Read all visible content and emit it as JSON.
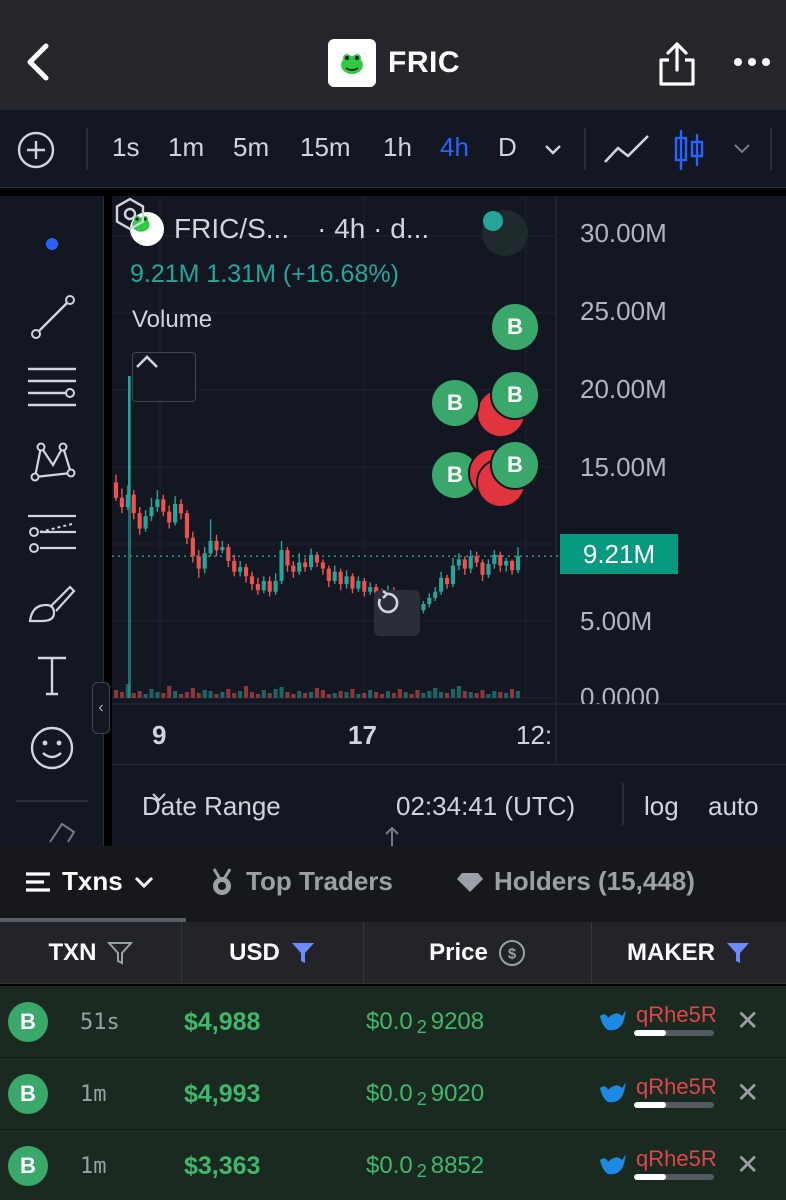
{
  "header": {
    "title": "FRIC"
  },
  "toolbar": {
    "timeframes": [
      "1s",
      "1m",
      "5m",
      "15m",
      "1h",
      "4h",
      "D"
    ],
    "active_timeframe": "4h"
  },
  "chart": {
    "legend_symbol": "FRIC/S...",
    "legend_interval": "· 4h · d...",
    "legend_values": "9.21M  1.31M (+16.68%)",
    "volume_label": "Volume",
    "y_ticks": [
      "30.00M",
      "25.00M",
      "20.00M",
      "15.00M",
      "5.00M",
      "0.0000"
    ],
    "current_price_label": "9.21M",
    "x_ticks": [
      "9",
      "17",
      "12:"
    ],
    "footer": {
      "date_range": "Date Range",
      "clock": "02:34:41 (UTC)",
      "log": "log",
      "auto": "auto"
    },
    "colors": {
      "up": "#26a69a",
      "down": "#ef5350",
      "accent": "#2962ff"
    }
  },
  "chart_data": {
    "type": "candlestick",
    "ylabel": "",
    "ylim": [
      0,
      30000000
    ],
    "current_value": 9210000,
    "candles": [
      [
        14.0,
        13.0,
        14.5,
        12.8
      ],
      [
        13.0,
        12.4,
        13.6,
        12.0
      ],
      [
        12.4,
        13.2,
        13.8,
        12.2
      ],
      [
        13.2,
        12.0,
        13.5,
        11.6
      ],
      [
        12.0,
        11.0,
        12.4,
        10.6
      ],
      [
        11.0,
        11.8,
        12.2,
        10.8
      ],
      [
        11.8,
        12.4,
        13.0,
        11.5
      ],
      [
        12.4,
        12.9,
        13.5,
        12.1
      ],
      [
        12.9,
        12.1,
        13.2,
        11.8
      ],
      [
        12.1,
        11.4,
        12.5,
        11.0
      ],
      [
        11.4,
        12.6,
        13.1,
        11.2
      ],
      [
        12.6,
        12.0,
        12.9,
        11.6
      ],
      [
        12.0,
        10.4,
        12.2,
        10.0
      ],
      [
        10.4,
        9.2,
        10.8,
        8.8
      ],
      [
        9.2,
        8.4,
        9.6,
        7.8
      ],
      [
        8.4,
        9.4,
        9.8,
        8.1
      ],
      [
        9.4,
        10.2,
        11.6,
        9.2
      ],
      [
        10.2,
        9.6,
        10.6,
        9.2
      ],
      [
        9.6,
        9.8,
        10.2,
        9.4
      ],
      [
        9.8,
        8.9,
        10.0,
        8.5
      ],
      [
        8.9,
        8.2,
        9.3,
        7.9
      ],
      [
        8.2,
        8.5,
        8.9,
        7.9
      ],
      [
        8.5,
        7.9,
        8.7,
        7.5
      ],
      [
        7.9,
        7.4,
        8.2,
        7.0
      ],
      [
        7.4,
        7.0,
        7.8,
        6.7
      ],
      [
        7.0,
        7.6,
        7.9,
        6.8
      ],
      [
        7.6,
        6.9,
        7.9,
        6.6
      ],
      [
        6.9,
        7.6,
        8.1,
        6.7
      ],
      [
        7.6,
        9.6,
        10.2,
        7.4
      ],
      [
        9.6,
        8.6,
        9.8,
        8.2
      ],
      [
        8.6,
        8.2,
        8.9,
        7.8
      ],
      [
        8.2,
        8.8,
        9.4,
        8.0
      ],
      [
        8.8,
        8.5,
        9.1,
        8.2
      ],
      [
        8.5,
        9.3,
        9.7,
        8.3
      ],
      [
        9.3,
        8.8,
        9.5,
        8.5
      ],
      [
        8.8,
        8.4,
        9.0,
        8.0
      ],
      [
        8.4,
        7.6,
        8.6,
        7.2
      ],
      [
        7.6,
        8.2,
        8.6,
        7.4
      ],
      [
        8.2,
        7.4,
        8.4,
        7.0
      ],
      [
        7.4,
        7.9,
        8.3,
        7.1
      ],
      [
        7.9,
        7.1,
        8.1,
        6.8
      ],
      [
        7.1,
        7.6,
        7.9,
        6.9
      ],
      [
        7.6,
        6.9,
        7.8,
        6.6
      ],
      [
        6.9,
        7.2,
        7.5,
        6.7
      ],
      [
        7.2,
        6.8,
        7.4,
        6.5
      ],
      [
        6.8,
        6.6,
        7.1,
        6.3
      ],
      [
        6.6,
        7.0,
        7.3,
        6.4
      ],
      [
        7.0,
        6.7,
        7.2,
        6.4
      ],
      [
        6.7,
        6.4,
        6.9,
        6.1
      ],
      [
        6.4,
        6.8,
        7.0,
        6.2
      ],
      [
        6.8,
        6.5,
        7.0,
        6.2
      ],
      [
        6.5,
        5.7,
        6.6,
        5.5
      ],
      [
        5.7,
        6.1,
        6.3,
        5.5
      ],
      [
        6.1,
        6.5,
        6.8,
        5.9
      ],
      [
        6.5,
        6.9,
        7.2,
        6.3
      ],
      [
        6.9,
        7.8,
        8.2,
        6.7
      ],
      [
        7.8,
        7.4,
        8.0,
        7.1
      ],
      [
        7.4,
        8.6,
        9.1,
        7.2
      ],
      [
        8.6,
        9.0,
        9.4,
        8.3
      ],
      [
        9.0,
        8.4,
        9.2,
        8.0
      ],
      [
        8.4,
        9.2,
        9.6,
        8.1
      ],
      [
        9.2,
        8.8,
        9.5,
        8.5
      ],
      [
        8.8,
        8.0,
        9.0,
        7.6
      ],
      [
        8.0,
        8.7,
        9.0,
        7.8
      ],
      [
        8.7,
        9.3,
        9.6,
        8.4
      ],
      [
        9.3,
        8.6,
        9.5,
        8.2
      ],
      [
        8.6,
        8.9,
        9.1,
        8.2
      ],
      [
        8.9,
        8.3,
        9.0,
        8.0
      ],
      [
        8.3,
        9.21,
        9.8,
        8.1
      ]
    ]
  },
  "tabs": [
    {
      "label": "Txns"
    },
    {
      "label": "Top Traders"
    },
    {
      "label": "Holders (15,448)"
    }
  ],
  "table": {
    "headers": [
      "TXN",
      "USD",
      "Price",
      "MAKER"
    ],
    "rows": [
      {
        "type": "B",
        "age": "51s",
        "usd": "$4,988",
        "price_prefix": "$0.0",
        "price_sub": "2",
        "price_tail": "9208",
        "maker": "qRhe5R",
        "maker_fill": 0.4
      },
      {
        "type": "B",
        "age": "1m",
        "usd": "$4,993",
        "price_prefix": "$0.0",
        "price_sub": "2",
        "price_tail": "9020",
        "maker": "qRhe5R",
        "maker_fill": 0.4
      },
      {
        "type": "B",
        "age": "1m",
        "usd": "$3,363",
        "price_prefix": "$0.0",
        "price_sub": "2",
        "price_tail": "8852",
        "maker": "qRhe5R",
        "maker_fill": 0.4
      }
    ]
  },
  "markers": [
    {
      "label": "B",
      "kind": "buy"
    },
    {
      "label": "B",
      "kind": "buy"
    },
    {
      "label": "B",
      "kind": "buy"
    },
    {
      "label": "B",
      "kind": "buy"
    },
    {
      "label": "B",
      "kind": "buy"
    }
  ]
}
